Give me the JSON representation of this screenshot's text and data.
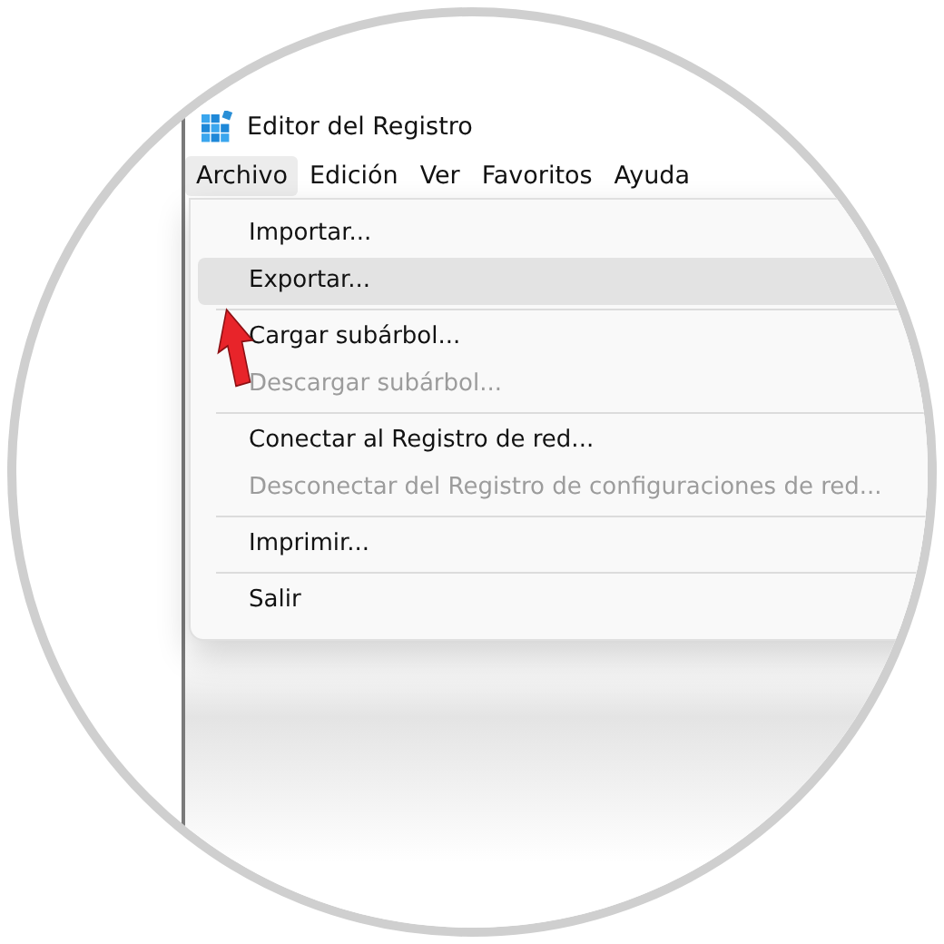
{
  "window": {
    "title": "Editor del Registro"
  },
  "menu_bar": [
    {
      "label": "Archivo",
      "selected": true
    },
    {
      "label": "Edición",
      "selected": false
    },
    {
      "label": "Ver",
      "selected": false
    },
    {
      "label": "Favoritos",
      "selected": false
    },
    {
      "label": "Ayuda",
      "selected": false
    }
  ],
  "dropdown_menu": {
    "groups": [
      [
        {
          "label": "Importar...",
          "disabled": false,
          "highlighted": false
        },
        {
          "label": "Exportar...",
          "disabled": false,
          "highlighted": true
        }
      ],
      [
        {
          "label": "Cargar subárbol...",
          "disabled": false,
          "highlighted": false
        },
        {
          "label": "Descargar subárbol...",
          "disabled": true,
          "highlighted": false
        }
      ],
      [
        {
          "label": "Conectar al Registro de red...",
          "disabled": false,
          "highlighted": false
        },
        {
          "label": "Desconectar del Registro de configuraciones de red...",
          "disabled": true,
          "highlighted": false
        }
      ],
      [
        {
          "label": "Imprimir...",
          "disabled": false,
          "highlighted": false
        }
      ],
      [
        {
          "label": "Salir",
          "disabled": false,
          "highlighted": false
        }
      ]
    ]
  }
}
